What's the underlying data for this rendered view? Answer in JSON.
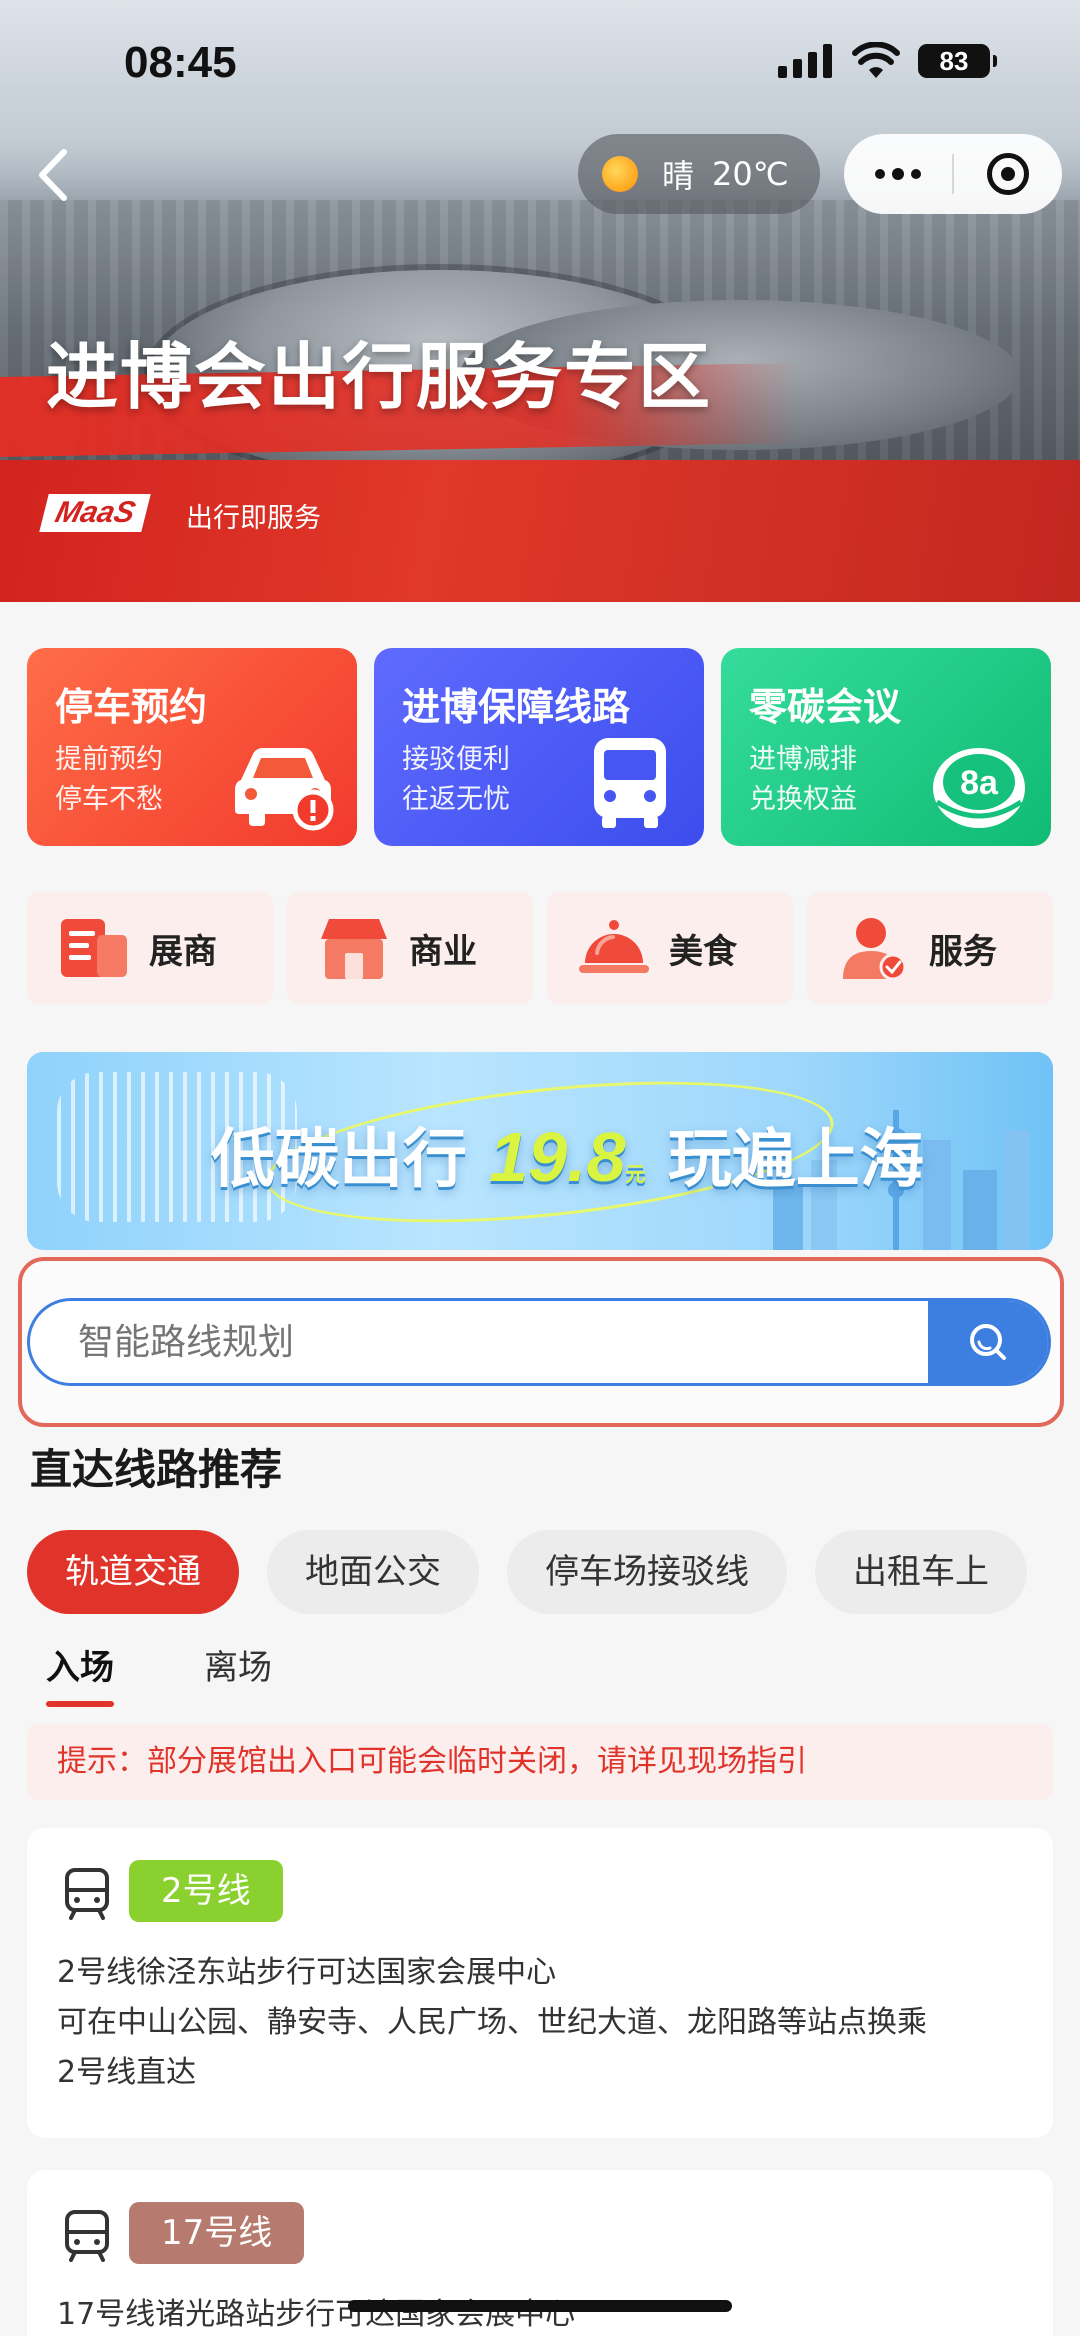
{
  "status_bar": {
    "time": "08:45",
    "battery": "83"
  },
  "header": {
    "weather_condition": "晴",
    "weather_temp": "20℃",
    "hero_title": "进博会出行服务专区",
    "logo_text": "MaaS",
    "logo_tagline": "出行即服务"
  },
  "services": [
    {
      "title": "停车预约",
      "line1": "提前预约",
      "line2": "停车不愁",
      "icon": "car-icon"
    },
    {
      "title": "进博保障线路",
      "line1": "接驳便利",
      "line2": "往返无忧",
      "icon": "bus-icon"
    },
    {
      "title": "零碳会议",
      "line1": "进博减排",
      "line2": "兑换权益",
      "icon": "eco-8a-icon"
    }
  ],
  "categories": [
    {
      "label": "展商",
      "icon": "exhibitor-icon"
    },
    {
      "label": "商业",
      "icon": "shop-icon"
    },
    {
      "label": "美食",
      "icon": "food-cloche-icon"
    },
    {
      "label": "服务",
      "icon": "service-person-icon"
    }
  ],
  "promo": {
    "text_before": "低碳出行",
    "price": "19.8",
    "unit": "元",
    "text_after": "玩遍上海"
  },
  "search": {
    "placeholder": "智能路线规划"
  },
  "routes": {
    "title": "直达线路推荐",
    "chips": [
      "轨道交通",
      "地面公交",
      "停车场接驳线",
      "出租车上"
    ],
    "active_chip": "轨道交通",
    "tabs": [
      "入场",
      "离场"
    ],
    "active_tab": "入场",
    "notice": "提示：部分展馆出入口可能会临时关闭，请详见现场指引",
    "cards": [
      {
        "line": "2号线",
        "color": "#8ad12f",
        "desc": [
          "2号线徐泾东站步行可达国家会展中心",
          "可在中山公园、静安寺、人民广场、世纪大道、龙阳路等站点换乘",
          "2号线直达"
        ]
      },
      {
        "line": "17号线",
        "color": "#b77a6f",
        "desc": [
          "17号线诸光路站步行可达国家会展中心"
        ]
      }
    ]
  },
  "colors": {
    "accent_red": "#e0342a",
    "search_blue": "#3d7fe0"
  }
}
